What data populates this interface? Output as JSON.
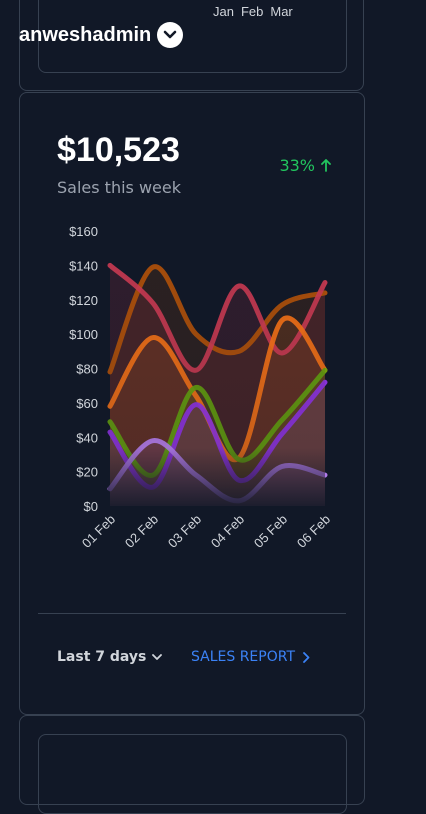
{
  "header": {
    "user_name": "anweshadmin"
  },
  "top_card": {
    "months": [
      "Jan",
      "Feb",
      "Mar"
    ]
  },
  "sales": {
    "total": "$10,523",
    "subtitle": "Sales this week",
    "growth": "33%",
    "range_label": "Last 7 days",
    "report_link": "SALES REPORT"
  },
  "chart_data": {
    "type": "area",
    "x": [
      "01 Feb",
      "02 Feb",
      "03 Feb",
      "04 Feb",
      "05 Feb",
      "06 Feb"
    ],
    "ylim": [
      0,
      160
    ],
    "yticks": [
      "$0",
      "$20",
      "$40",
      "$60",
      "$80",
      "$100",
      "$120",
      "$140",
      "$160"
    ],
    "series": [
      {
        "color": "#b45309",
        "values": [
          78,
          139,
          100,
          90,
          117,
          124
        ]
      },
      {
        "color": "#cc3b52",
        "values": [
          140,
          118,
          79,
          128,
          89,
          130
        ]
      },
      {
        "color": "#f97316",
        "values": [
          58,
          98,
          64,
          28,
          108,
          79
        ]
      },
      {
        "color": "#65a30d",
        "values": [
          49,
          18,
          69,
          27,
          50,
          79
        ]
      },
      {
        "color": "#9333ea",
        "values": [
          43,
          11,
          59,
          15,
          42,
          72
        ]
      },
      {
        "color": "#c084fc",
        "values": [
          10,
          38,
          18,
          3,
          23,
          18
        ]
      }
    ]
  }
}
